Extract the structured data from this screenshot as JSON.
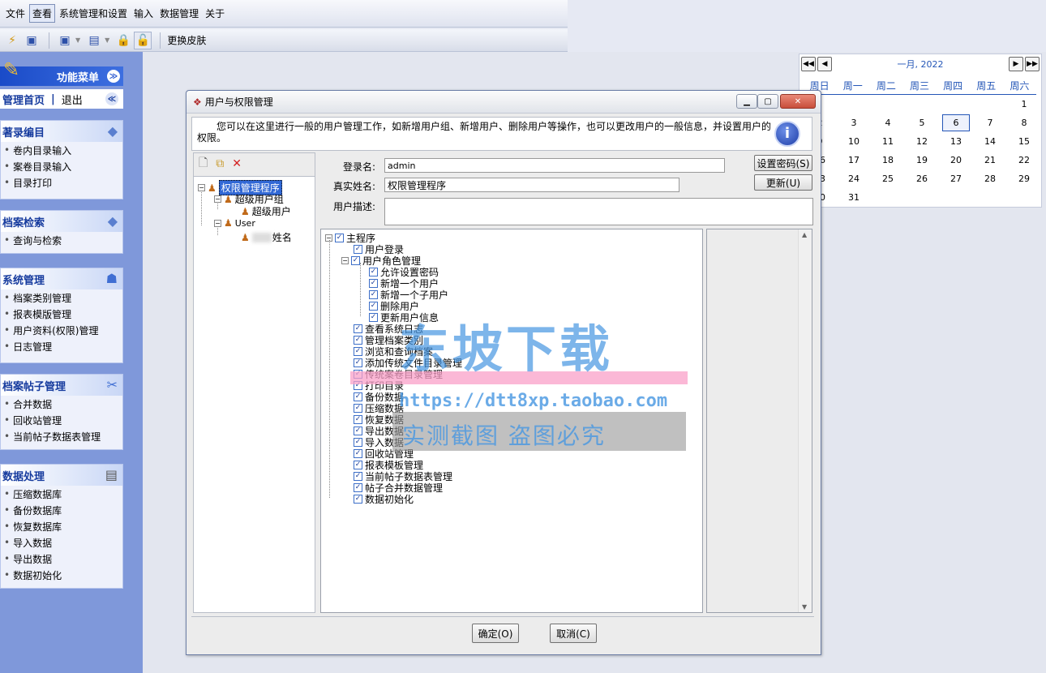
{
  "menubar": {
    "items": [
      "文件",
      "查看",
      "系统管理和设置",
      "输入",
      "数据管理",
      "关于"
    ],
    "active": "查看"
  },
  "toolbar": {
    "skin_label": "更换皮肤"
  },
  "sidebar": {
    "header": "功能菜单",
    "home": "管理首页",
    "separator": "|",
    "logout": "退出",
    "sections": [
      {
        "title": "著录编目",
        "icon": "catalog-icon",
        "items": [
          "卷内目录输入",
          "案卷目录输入",
          "目录打印"
        ]
      },
      {
        "title": "档案检索",
        "icon": "search-icon",
        "items": [
          "查询与检索"
        ]
      },
      {
        "title": "系统管理",
        "icon": "users-icon",
        "items": [
          "档案类别管理",
          "报表模版管理",
          "用户资料(权限)管理",
          "日志管理"
        ]
      },
      {
        "title": "档案帖子管理",
        "icon": "tools-icon",
        "items": [
          "合并数据",
          "回收站管理",
          "当前帖子数据表管理"
        ]
      },
      {
        "title": "数据处理",
        "icon": "database-icon",
        "items": [
          "压缩数据库",
          "备份数据库",
          "恢复数据库",
          "导入数据",
          "导出数据",
          "数据初始化"
        ]
      }
    ]
  },
  "calendar": {
    "title": "一月, 2022",
    "weekdays": [
      "周日",
      "周一",
      "周二",
      "周三",
      "周四",
      "周五",
      "周六"
    ],
    "first_weekday": 6,
    "days": 31,
    "today": 6
  },
  "dialog": {
    "title": "用户与权限管理",
    "info": "您可以在这里进行一般的用户管理工作，如新增用户组、新增用户、删除用户等操作，也可以更改用户的一般信息，并设置用户的权限。",
    "tree": {
      "root": "权限管理程序",
      "groups": [
        {
          "name": "超级用户组",
          "users": [
            "超级用户"
          ]
        },
        {
          "name": "User",
          "users": [
            "姓名"
          ]
        }
      ]
    },
    "form": {
      "login_label": "登录名:",
      "login_value": "admin",
      "realname_label": "真实姓名:",
      "realname_value": "权限管理程序",
      "desc_label": "用户描述:",
      "desc_value": "",
      "set_password": "设置密码(S)",
      "update": "更新(U)"
    },
    "permissions": {
      "root": "主程序",
      "items": [
        {
          "label": "用户登录",
          "level": 1
        },
        {
          "label": "用户角色管理",
          "level": 1,
          "expand": true
        },
        {
          "label": "允许设置密码",
          "level": 2
        },
        {
          "label": "新增一个用户",
          "level": 2
        },
        {
          "label": "新增一个子用户",
          "level": 2
        },
        {
          "label": "删除用户",
          "level": 2
        },
        {
          "label": "更新用户信息",
          "level": 2
        },
        {
          "label": "查看系统日志",
          "level": 1
        },
        {
          "label": "管理档案类别",
          "level": 1
        },
        {
          "label": "浏览和查询档案",
          "level": 1
        },
        {
          "label": "添加传统文件目录管理",
          "level": 1
        },
        {
          "label": "传统案卷目录管理",
          "level": 1
        },
        {
          "label": "打印目录",
          "level": 1
        },
        {
          "label": "备份数据",
          "level": 1
        },
        {
          "label": "压缩数据",
          "level": 1
        },
        {
          "label": "恢复数据",
          "level": 1
        },
        {
          "label": "导出数据",
          "level": 1
        },
        {
          "label": "导入数据",
          "level": 1
        },
        {
          "label": "回收站管理",
          "level": 1
        },
        {
          "label": "报表模板管理",
          "level": 1
        },
        {
          "label": "当前帖子数据表管理",
          "level": 1
        },
        {
          "label": "帖子合并数据管理",
          "level": 1
        },
        {
          "label": "数据初始化",
          "level": 1
        }
      ]
    },
    "ok": "确定(O)",
    "cancel": "取消(C)"
  },
  "watermark": {
    "title": "东坡下载",
    "url": "https://dtt8xp.taobao.com",
    "sub": "实测截图 盗图必究"
  }
}
